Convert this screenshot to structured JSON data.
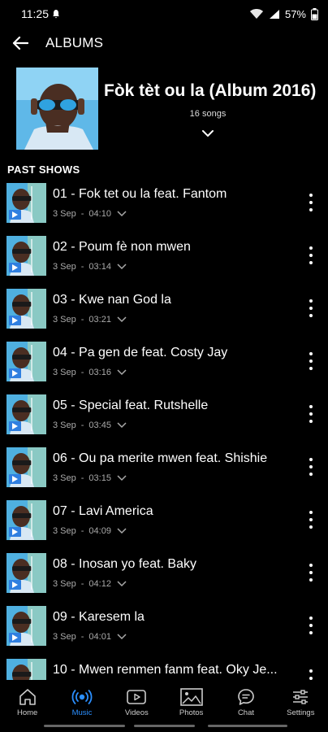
{
  "status": {
    "time": "11:25",
    "battery": "57%"
  },
  "header": {
    "title": "ALBUMS"
  },
  "album": {
    "title": "Fòk tèt ou la (Album 2016)",
    "song_count": "16 songs"
  },
  "section": {
    "label": "PAST SHOWS"
  },
  "tracks": [
    {
      "title": "01 - Fok tet ou la feat. Fantom",
      "date": "3 Sep",
      "duration": "04:10"
    },
    {
      "title": "02 - Poum fè non mwen",
      "date": "3 Sep",
      "duration": "03:14"
    },
    {
      "title": "03 - Kwe nan God la",
      "date": "3 Sep",
      "duration": "03:21"
    },
    {
      "title": "04 - Pa gen de feat. Costy Jay",
      "date": "3 Sep",
      "duration": "03:16"
    },
    {
      "title": "05 - Special feat. Rutshelle",
      "date": "3 Sep",
      "duration": "03:45"
    },
    {
      "title": "06 - Ou pa merite mwen feat. Shishie",
      "date": "3 Sep",
      "duration": "03:15"
    },
    {
      "title": "07 - Lavi America",
      "date": "3 Sep",
      "duration": "04:09"
    },
    {
      "title": "08 - Inosan yo feat. Baky",
      "date": "3 Sep",
      "duration": "04:12"
    },
    {
      "title": "09 - Karesem la",
      "date": "3 Sep",
      "duration": "04:01"
    },
    {
      "title": "10 - Mwen renmen fanm  feat. Oky Je...",
      "date": "",
      "duration": ""
    }
  ],
  "nav": {
    "home": "Home",
    "music": "Music",
    "videos": "Videos",
    "photos": "Photos",
    "chat": "Chat",
    "settings": "Settings"
  },
  "colors": {
    "accent": "#2b8fff",
    "background": "#000000",
    "muted_text": "#aaaaaa"
  }
}
